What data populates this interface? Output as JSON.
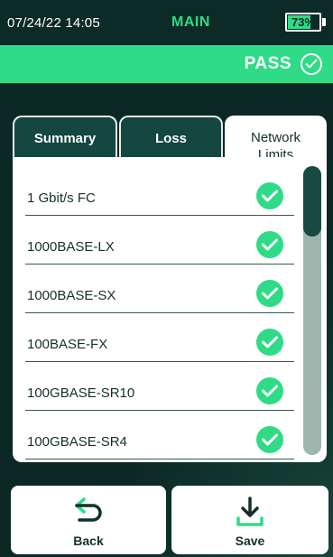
{
  "status_bar": {
    "datetime": "07/24/22 14:05",
    "mode": "MAIN",
    "battery": {
      "text": "73%",
      "level_percent": 73
    }
  },
  "result_banner": {
    "text": "PASS",
    "icon": "check-circle-icon",
    "color": "#2fdb86"
  },
  "tabs": [
    {
      "label": "Summary",
      "active": false
    },
    {
      "label": "Loss",
      "active": false
    },
    {
      "label": "Network\nLimits",
      "active": true
    }
  ],
  "network_limits": [
    {
      "name": "1 Gbit/s FC",
      "status": "pass",
      "icon": "check-circle-icon"
    },
    {
      "name": "1000BASE-LX",
      "status": "pass",
      "icon": "check-circle-icon"
    },
    {
      "name": "1000BASE-SX",
      "status": "pass",
      "icon": "check-circle-icon"
    },
    {
      "name": "100BASE-FX",
      "status": "pass",
      "icon": "check-circle-icon"
    },
    {
      "name": "100GBASE-SR10",
      "status": "pass",
      "icon": "check-circle-icon"
    },
    {
      "name": "100GBASE-SR4",
      "status": "pass",
      "icon": "check-circle-icon"
    }
  ],
  "actions": {
    "back": {
      "label": "Back",
      "icon": "back-arrow-icon"
    },
    "save": {
      "label": "Save",
      "icon": "download-icon"
    }
  },
  "colors": {
    "accent_green": "#2fdb86",
    "dark_teal": "#0c2824",
    "tab_inactive": "#134740"
  }
}
